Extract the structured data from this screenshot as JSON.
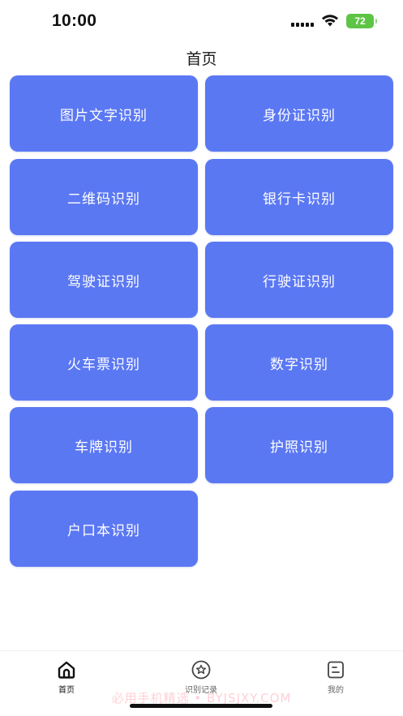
{
  "status_bar": {
    "time": "10:00",
    "battery": "72"
  },
  "header": {
    "title": "首页"
  },
  "features": [
    "图片文字识别",
    "身份证识别",
    "二维码识别",
    "银行卡识别",
    "驾驶证识别",
    "行驶证识别",
    "火车票识别",
    "数字识别",
    "车牌识别",
    "护照识别",
    "户口本识别"
  ],
  "tab_bar": {
    "tabs": [
      {
        "label": "首页",
        "icon": "home-icon",
        "active": true
      },
      {
        "label": "识别记录",
        "icon": "star-circle-icon",
        "active": false
      },
      {
        "label": "我的",
        "icon": "profile-card-icon",
        "active": false
      }
    ]
  },
  "watermark": "必用手机精选 • BYJSJXY.COM",
  "colors": {
    "card": "#5b78f3",
    "battery": "#5ec445"
  }
}
